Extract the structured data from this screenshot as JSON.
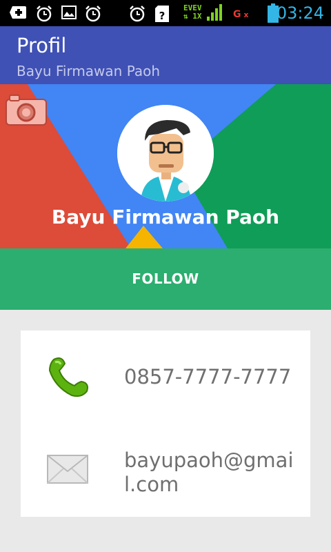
{
  "status_bar": {
    "time": "03:24",
    "network_label": "EVEV",
    "network_sub": "1X",
    "data_label": "G",
    "icons": [
      "add-icon",
      "alarm-icon",
      "image-icon",
      "alarm-icon",
      "alarm-icon",
      "sd-card-question-icon",
      "signal-icon",
      "battery-icon"
    ]
  },
  "app_bar": {
    "title": "Profil",
    "subtitle": "Bayu Firmawan Paoh"
  },
  "header": {
    "name": "Bayu Firmawan Paoh",
    "colors": {
      "red": "#dd4b39",
      "blue": "#4285f4",
      "green": "#0f9d58",
      "yellow": "#f4b400"
    }
  },
  "follow": {
    "label": "FOLLOW",
    "color": "#2bae6f"
  },
  "contacts": [
    {
      "icon": "phone-icon",
      "text": "0857-7777-7777"
    },
    {
      "icon": "email-icon",
      "text": "bayupaoh@gmail.com"
    }
  ]
}
